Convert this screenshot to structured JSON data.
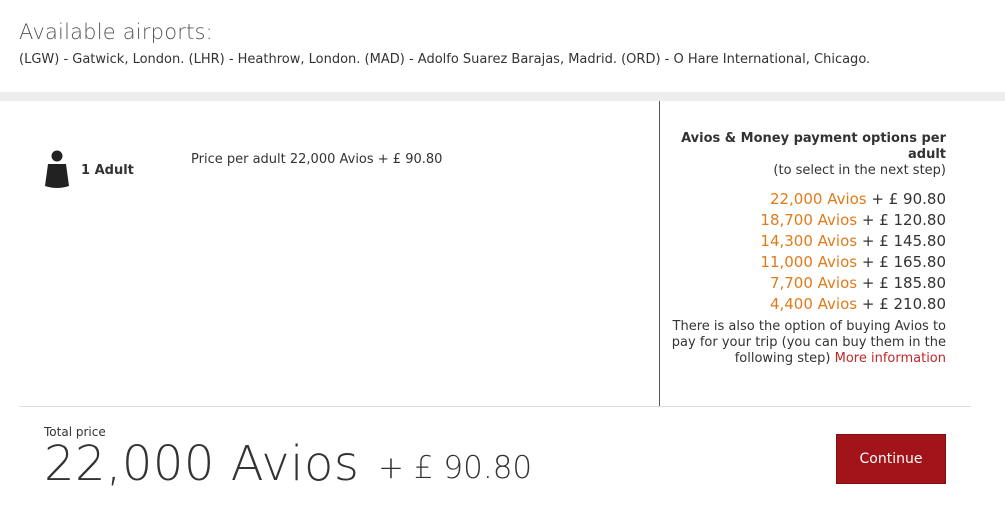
{
  "airports": {
    "title": "Available airports:",
    "list": "(LGW) - Gatwick, London.  (LHR) - Heathrow, London.  (MAD) - Adolfo Suarez Barajas, Madrid.  (ORD) - O Hare International, Chicago."
  },
  "passenger": {
    "icon": "person-icon",
    "label": "1 Adult",
    "price_per_adult": "Price per adult 22,000 Avios + £ 90.80"
  },
  "payment_options": {
    "title": "Avios & Money payment options per adult",
    "subtitle": "(to select in the next step)",
    "options": [
      {
        "avios": "22,000 Avios",
        "money": " + £ 90.80"
      },
      {
        "avios": "18,700 Avios",
        "money": " + £ 120.80"
      },
      {
        "avios": "14,300 Avios",
        "money": " + £ 145.80"
      },
      {
        "avios": "11,000 Avios",
        "money": " + £ 165.80"
      },
      {
        "avios": "7,700 Avios",
        "money": " + £ 185.80"
      },
      {
        "avios": "4,400 Avios",
        "money": " + £ 210.80"
      }
    ],
    "note": "There is also the option of buying Avios to pay for your trip (you can buy them in the following step)",
    "more_link": "More information"
  },
  "total": {
    "label": "Total price",
    "avios": "22,000 Avios",
    "money": "+ £ 90.80"
  },
  "continue_label": "Continue",
  "colors": {
    "accent_orange": "#e07b1a",
    "button_red": "#a3141a",
    "link_red": "#c0272d"
  }
}
